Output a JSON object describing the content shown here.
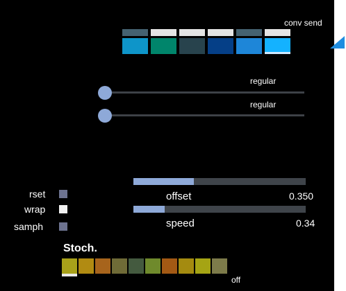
{
  "conv_send": {
    "label": "conv send",
    "tabs": [
      {
        "color": "#456271"
      },
      {
        "color": "#e4e4e4"
      },
      {
        "color": "#e4e4e4"
      },
      {
        "color": "#e4e4e4"
      },
      {
        "color": "#456271"
      },
      {
        "color": "#e4e4e4"
      }
    ],
    "swatches": [
      {
        "color": "#0e95c9"
      },
      {
        "color": "#00856b"
      },
      {
        "color": "#28434d"
      },
      {
        "color": "#053f87"
      },
      {
        "color": "#1e86d8"
      },
      {
        "color": "#14b2ff",
        "selected": true
      }
    ]
  },
  "arrow_icon": {
    "name": "arrow-icon",
    "color": "#1f8de0"
  },
  "sliders": [
    {
      "label": "regular",
      "value": 0.0
    },
    {
      "label": "regular",
      "value": 0.0
    }
  ],
  "toggles": [
    {
      "label": "rset",
      "on": false
    },
    {
      "label": "wrap",
      "on": true
    },
    {
      "label": "samph",
      "on": false
    }
  ],
  "params": [
    {
      "label": "offset",
      "value_text": "0.350",
      "fill": 0.35
    },
    {
      "label": "speed",
      "value_text": "0.34",
      "fill": 0.18
    }
  ],
  "stoch": {
    "title": "Stoch.",
    "value_label": "off",
    "swatches": [
      {
        "color": "#a8a11a",
        "selected": true
      },
      {
        "color": "#b18b12"
      },
      {
        "color": "#a7641c"
      },
      {
        "color": "#6f6b37"
      },
      {
        "color": "#445a3f"
      },
      {
        "color": "#6f8a2c"
      },
      {
        "color": "#a35914"
      },
      {
        "color": "#a48b10"
      },
      {
        "color": "#a5a414"
      },
      {
        "color": "#7d7b4a"
      }
    ]
  }
}
